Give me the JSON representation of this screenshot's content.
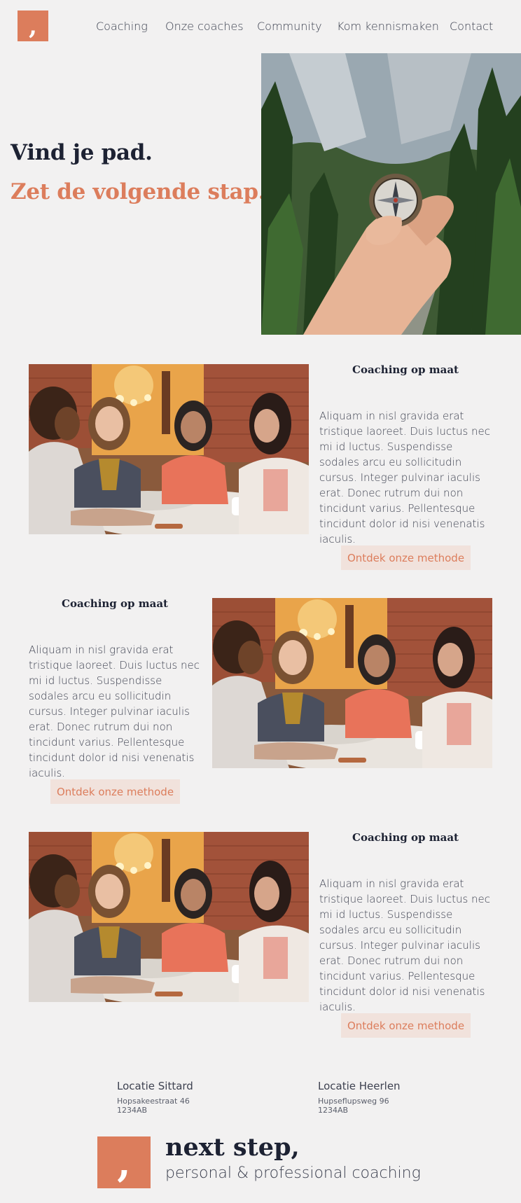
{
  "colors": {
    "accent": "#dc7d5c",
    "ink": "#1d2233",
    "background": "#f2f1f1",
    "cta_background": "#f1e2dc"
  },
  "nav": {
    "logo_glyph": ",",
    "links": [
      "Coaching",
      "Onze coaches",
      "Community",
      "Kom kennismaken",
      "Contact"
    ]
  },
  "hero": {
    "title": "Vind je pad.",
    "subtitle": "Zet de volgende stap.",
    "image": "hand-holding-compass-forest-photo"
  },
  "sections": [
    {
      "title": "Coaching op maat",
      "body": "Aliquam in nisl gravida erat tristique laoreet. Duis luctus nec mi id luctus. Suspendisse sodales arcu eu sollicitudin cursus. Integer pulvinar iaculis erat. Donec rutrum dui non tincidunt varius. Pellentesque tincidunt dolor id nisi venenatis iaculis.",
      "cta": "Ontdek onze methode",
      "image": "four-women-cafe-meeting-photo"
    },
    {
      "title": "Coaching op maat",
      "body": "Aliquam in nisl gravida erat tristique laoreet. Duis luctus nec mi id luctus. Suspendisse sodales arcu eu sollicitudin cursus. Integer pulvinar iaculis erat. Donec rutrum dui non tincidunt varius. Pellentesque tincidunt dolor id nisi venenatis iaculis.",
      "cta": "Ontdek onze methode",
      "image": "four-women-cafe-meeting-photo"
    },
    {
      "title": "Coaching op maat",
      "body": "Aliquam in nisl gravida erat tristique laoreet. Duis luctus nec mi id luctus. Suspendisse sodales arcu eu sollicitudin cursus. Integer pulvinar iaculis erat. Donec rutrum dui non tincidunt varius. Pellentesque tincidunt dolor id nisi venenatis iaculis.",
      "cta": "Ontdek onze methode",
      "image": "four-women-cafe-meeting-photo"
    }
  ],
  "footer": {
    "locations": [
      {
        "title": "Locatie Sittard",
        "street": "Hopsakeestraat 46",
        "postcode": "1234AB"
      },
      {
        "title": "Locatie Heerlen",
        "street": "Hupseflupsweg 96",
        "postcode": "1234AB"
      }
    ],
    "brand_glyph": ",",
    "brand_name": "next step,",
    "brand_tagline": "personal & professional coaching"
  }
}
